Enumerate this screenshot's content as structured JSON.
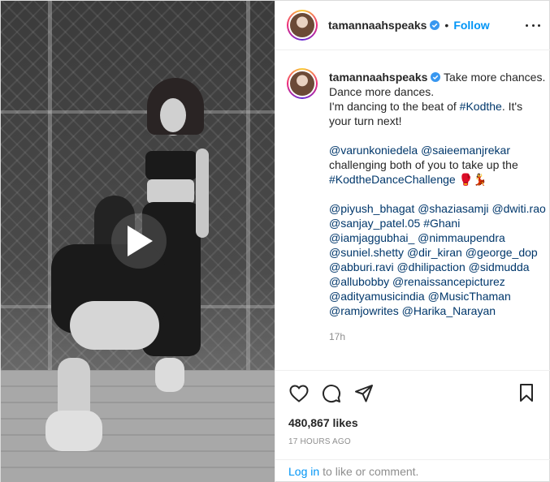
{
  "post": {
    "username": "tamannaahspeaks",
    "header_separator": "•",
    "follow_label": "Follow",
    "caption": {
      "line1": "Take more chances. Dance more dances.",
      "line2_prefix": "I'm dancing to the beat of ",
      "line2_tag": "#Kodthe",
      "line2_suffix": ". It's your turn next!",
      "mention1": "@varunkoniedela",
      "mention2": "@saieemanjrekar",
      "line3": "challenging both of you to take up the",
      "tag2": "#KodtheDanceChallenge",
      "emoji": "🥊💃",
      "tags_block": [
        "@piyush_bhagat",
        "@shaziasamji",
        "@dwiti.rao",
        "@sanjay_patel.05",
        "#Ghani",
        "@iamjaggubhai_",
        "@nimmaupendra",
        "@suniel.shetty",
        "@dir_kiran",
        "@george_dop",
        "@abburi.ravi",
        "@dhilipaction",
        "@sidmudda",
        "@allubobby",
        "@renaissancepicturez",
        "@adityamusicindia",
        "@MusicThaman",
        "@ramjowrites",
        "@Harika_Narayan"
      ],
      "age": "17h"
    },
    "likes": "480,867 likes",
    "posted": "17 HOURS AGO",
    "login_label": "Log in",
    "comment_prompt": "to like or comment."
  },
  "colors": {
    "link_blue": "#0095f6",
    "mention_blue": "#00376b",
    "muted": "#8e8e8e",
    "verified": "#3897f0"
  },
  "icons": {
    "verified": "verified-badge-icon",
    "more": "more-options-icon",
    "play": "play-icon",
    "like": "heart-icon",
    "comment": "comment-icon",
    "share": "share-icon",
    "save": "bookmark-icon"
  }
}
